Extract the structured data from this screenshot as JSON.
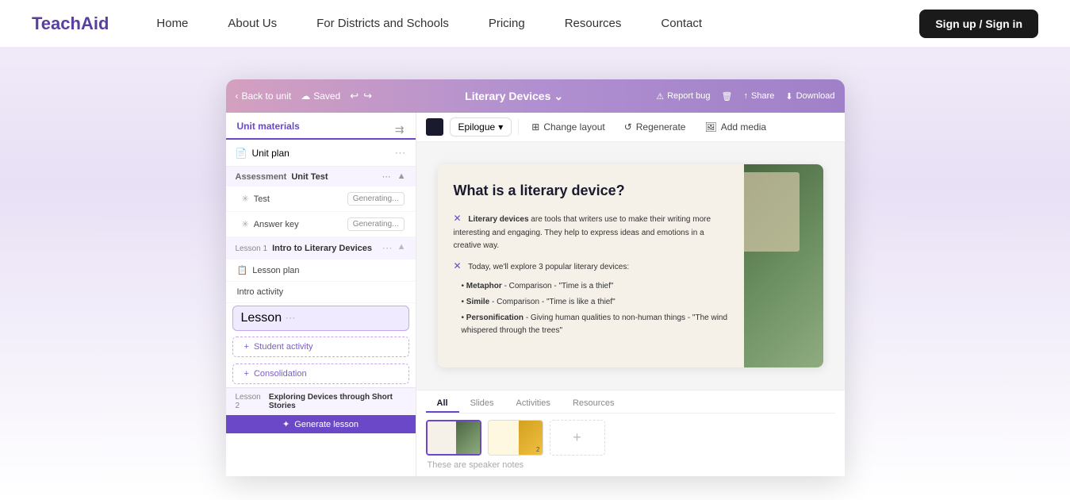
{
  "navbar": {
    "logo": "TeachAid",
    "links": [
      {
        "label": "Home",
        "active": false
      },
      {
        "label": "About Us",
        "active": false
      },
      {
        "label": "For Districts and Schools",
        "active": false
      },
      {
        "label": "Pricing",
        "active": false
      },
      {
        "label": "Resources",
        "active": false
      },
      {
        "label": "Contact",
        "active": false
      }
    ],
    "cta": "Sign up / Sign in"
  },
  "topbar": {
    "back": "Back to unit",
    "saved": "Saved",
    "title": "Literary Devices",
    "report_bug": "Report bug",
    "share": "Share",
    "download": "Download"
  },
  "sidebar": {
    "tab": "Unit materials",
    "unit_plan": "Unit plan",
    "assessment_label": "Assessment",
    "assessment_title": "Unit Test",
    "test": "Test",
    "answer_key": "Answer key",
    "generating": "Generating...",
    "lesson1_label": "Lesson 1",
    "lesson1_title": "Intro to Literary Devices",
    "lesson_plan": "Lesson plan",
    "intro_activity": "Intro activity",
    "lesson": "Lesson",
    "student_activity": "Student activity",
    "consolidation": "Consolidation",
    "lesson2_label": "Lesson 2",
    "lesson2_title": "Exploring Devices through Short Stories",
    "generate_lesson": "Generate lesson"
  },
  "toolbar": {
    "epilogue": "Epilogue",
    "change_layout": "Change layout",
    "regenerate": "Regenerate",
    "add_media": "Add media"
  },
  "slide": {
    "title": "What is a literary device?",
    "body": {
      "intro": "are tools that writers use to make their writing more interesting and engaging. They help to express ideas and emotions in a creative way.",
      "bold_intro": "Literary devices",
      "today": "Today, we'll explore 3 popular literary devices:",
      "bullets": [
        {
          "bold": "Metaphor",
          "text": "- Comparison - \"Time is a thief\""
        },
        {
          "bold": "Simile",
          "text": "- Comparison - \"Time is like a thief\""
        },
        {
          "bold": "Personification",
          "text": "- Giving human qualities to non-human things - \"The wind whispered through the trees\""
        }
      ]
    }
  },
  "bottom": {
    "tabs": [
      "All",
      "Slides",
      "Activities",
      "Resources"
    ],
    "active_tab": "All",
    "speaker_notes": "These are speaker notes"
  },
  "colors": {
    "purple_accent": "#6b48c8",
    "dark_navy": "#1a1a2e",
    "gradient_start": "#d4a0c0",
    "gradient_end": "#a080c8"
  }
}
